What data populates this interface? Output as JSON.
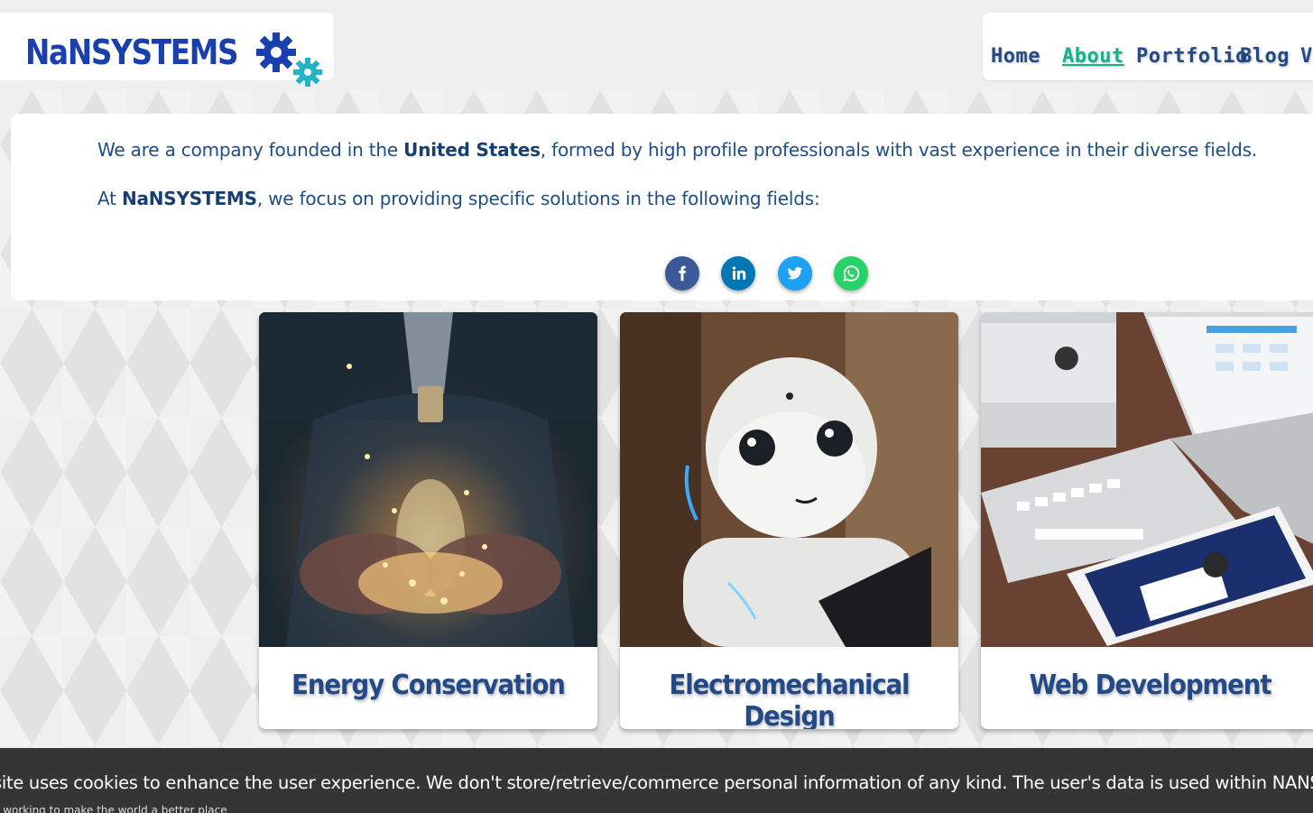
{
  "header": {
    "logo_text": "NaNSYSTEMS",
    "nav": [
      {
        "label": "Home",
        "active": false
      },
      {
        "label": "About",
        "active": true
      },
      {
        "label": "Portfolio",
        "active": false
      },
      {
        "label": "Blog",
        "active": false
      },
      {
        "label": "V",
        "active": false
      }
    ]
  },
  "about": {
    "p1_before": "We are a company founded in the ",
    "p1_bold": "United States",
    "p1_after": ", formed by high profile professionals with vast experience in their diverse fields.",
    "p2_before": "At ",
    "p2_bold": "NaNSYSTEMS",
    "p2_after": ", we focus on providing specific solutions in the following fields:"
  },
  "social": [
    {
      "icon": "facebook-icon",
      "glyph": "f",
      "color": "#3b5998"
    },
    {
      "icon": "linkedin-icon",
      "glyph": "in",
      "color": "#0077b5"
    },
    {
      "icon": "twitter-icon",
      "glyph": "t",
      "color": "#1da1f2"
    },
    {
      "icon": "whatsapp-icon",
      "glyph": "w",
      "color": "#25d366"
    }
  ],
  "cards": [
    {
      "title": "Energy Conservation"
    },
    {
      "title": "Electromechanical Design"
    },
    {
      "title": "Web Development"
    }
  ],
  "cookie": {
    "text": "site uses cookies to enhance the user experience. We don't store/retrieve/commerce personal information of any kind. The user's data is used within NANSYSTEMS with t",
    "subtext": "e working to make the world a better place"
  },
  "colors": {
    "brand_blue": "#1a3fae",
    "nav_text": "#234a86",
    "nav_active": "#19b08e",
    "cookie_bg": "#353535"
  }
}
